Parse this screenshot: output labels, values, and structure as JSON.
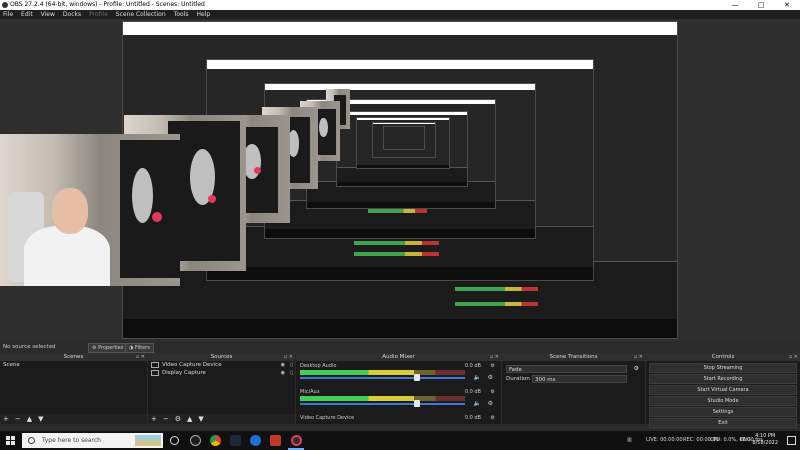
{
  "window": {
    "title": "OBS 27.2.4 (64-bit, windows) - Profile: Untitled - Scenes: Untitled",
    "controls": [
      "—",
      "□",
      "✕"
    ]
  },
  "menu": [
    "File",
    "Edit",
    "View",
    "Docks",
    "Profile",
    "Scene Collection",
    "Tools",
    "Help"
  ],
  "source_bar": {
    "status": "No source selected",
    "properties_label": "Properties",
    "filters_label": "Filters"
  },
  "docks": {
    "scenes": {
      "title": "Scenes",
      "items": [
        "Scene"
      ]
    },
    "sources": {
      "title": "Sources",
      "items": [
        "Video Capture Device",
        "Display Capture"
      ]
    },
    "mixer": {
      "title": "Audio Mixer",
      "tracks": [
        {
          "name": "Desktop Audio",
          "db": "0.0 dB",
          "level": 0.69
        },
        {
          "name": "Mic/Aux",
          "db": "0.0 dB",
          "level": 0.69
        },
        {
          "name": "Video Capture Device",
          "db": "0.0 dB",
          "level": 0.69
        }
      ]
    },
    "transitions": {
      "title": "Scene Transitions",
      "selected": "Fade",
      "duration_label": "Duration",
      "duration_value": "300 ms"
    },
    "controls": {
      "title": "Controls",
      "buttons": [
        "Stop Streaming",
        "Start Recording",
        "Start Virtual Camera",
        "Studio Mode",
        "Settings",
        "Exit"
      ]
    }
  },
  "footer_icons": [
    "+",
    "−",
    "▲",
    "▼"
  ],
  "status": {
    "live": "LIVE: 00:00:00",
    "rec": "REC: 00:00:00",
    "cpu": "CPU: 0.0%, 60.00 fps"
  },
  "taskbar": {
    "search_placeholder": "Type here to search",
    "language": "ENG",
    "time": "4:10 PM",
    "date": "8/18/2022"
  },
  "colors": {
    "accent_blue": "#3a7bd5",
    "meter_green": "#3fcf5a",
    "meter_yellow": "#d8cc3a",
    "obs_red": "#e23b5a"
  }
}
